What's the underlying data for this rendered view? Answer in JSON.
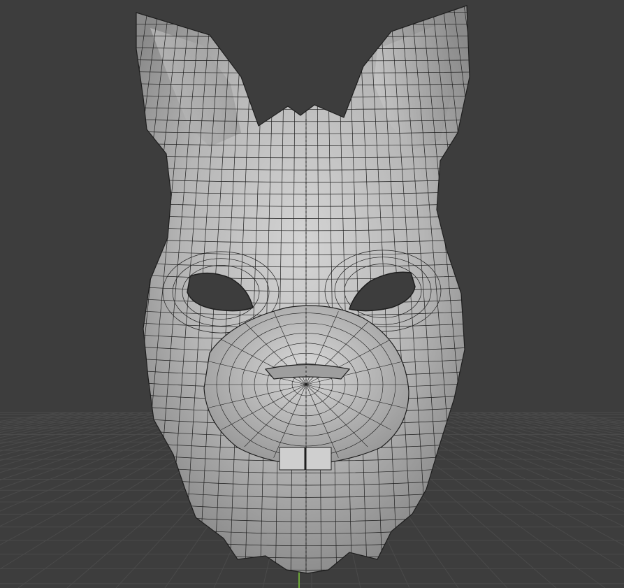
{
  "viewport": {
    "background_color": "#3d3d3d",
    "grid_color": "#4a4a4a",
    "z_axis_color": "#6fa83a",
    "mesh_fill": "#bdbdbd",
    "mesh_wire": "#1e1e1e",
    "object": "rabbit-mask-mesh",
    "overlay": "wireframe"
  }
}
